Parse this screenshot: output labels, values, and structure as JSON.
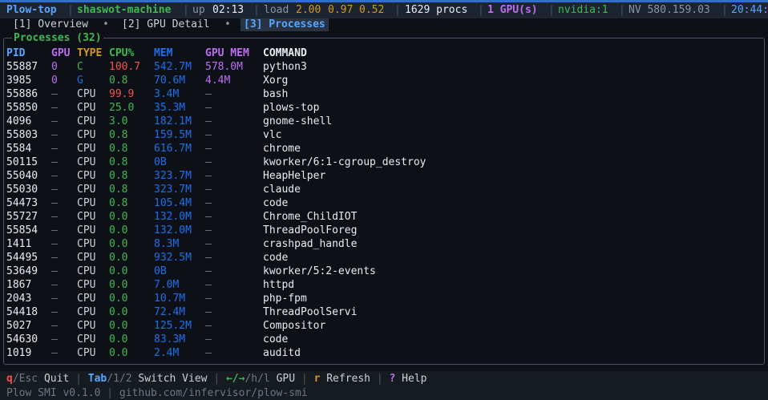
{
  "colors": {
    "header_pid": "#58a6ff",
    "header_gpu": "#bc6ff1",
    "header_type": "#d29922",
    "header_cpu": "#3fb950",
    "header_mem": "#1f6feb",
    "header_gmem": "#bc6ff1",
    "header_cmd": "#e6edf3",
    "cpu_high": "#f85149",
    "cpu_normal": "#3fb950",
    "mem": "#1f6feb",
    "gpu_index": "#bc6ff1",
    "type_compute": "#3fb950",
    "type_graphics": "#1f6feb",
    "type_cpu": "#c9d1d9",
    "dash": "#6e7681"
  },
  "topbar": {
    "app": "Plow-top",
    "host": "shaswot-machine",
    "uptime_label": "up",
    "uptime": "02:13",
    "load_label": "load",
    "load1": "2.00",
    "load5": "0.97",
    "load15": "0.52",
    "procs": "1629 procs",
    "gpus": "1 GPU(s)",
    "vendor": "nvidia:1",
    "driver": "NV 580.159.03",
    "clock": "20:44:"
  },
  "tabs": [
    {
      "label": "[1] Overview"
    },
    {
      "label": "[2] GPU Detail"
    },
    {
      "label": "[3] Processes"
    }
  ],
  "tab_separator": "•",
  "panel": {
    "title": "Processes (32)"
  },
  "table": {
    "headers": {
      "pid": "PID",
      "gpu": "GPU",
      "type": "TYPE",
      "cpu": "CPU%",
      "mem": "MEM",
      "gmem": "GPU MEM",
      "cmd": "COMMAND"
    },
    "rows": [
      {
        "pid": "55887",
        "gpu": "0",
        "type": "C",
        "cpu": "100.7",
        "mem": "542.7M",
        "gmem": "578.0M",
        "cmd": "python3"
      },
      {
        "pid": "3985",
        "gpu": "0",
        "type": "G",
        "cpu": "0.8",
        "mem": "70.6M",
        "gmem": "4.4M",
        "cmd": "Xorg"
      },
      {
        "pid": "55886",
        "gpu": "—",
        "type": "CPU",
        "cpu": "99.9",
        "mem": "3.4M",
        "gmem": "—",
        "cmd": "bash"
      },
      {
        "pid": "55850",
        "gpu": "—",
        "type": "CPU",
        "cpu": "25.0",
        "mem": "35.3M",
        "gmem": "—",
        "cmd": "plows-top"
      },
      {
        "pid": "4096",
        "gpu": "—",
        "type": "CPU",
        "cpu": "3.0",
        "mem": "182.1M",
        "gmem": "—",
        "cmd": "gnome-shell"
      },
      {
        "pid": "55803",
        "gpu": "—",
        "type": "CPU",
        "cpu": "0.8",
        "mem": "159.5M",
        "gmem": "—",
        "cmd": "vlc"
      },
      {
        "pid": "5584",
        "gpu": "—",
        "type": "CPU",
        "cpu": "0.8",
        "mem": "616.7M",
        "gmem": "—",
        "cmd": "chrome"
      },
      {
        "pid": "50115",
        "gpu": "—",
        "type": "CPU",
        "cpu": "0.8",
        "mem": "0B",
        "gmem": "—",
        "cmd": "kworker/6:1-cgroup_destroy"
      },
      {
        "pid": "55040",
        "gpu": "—",
        "type": "CPU",
        "cpu": "0.8",
        "mem": "323.7M",
        "gmem": "—",
        "cmd": "HeapHelper"
      },
      {
        "pid": "55030",
        "gpu": "—",
        "type": "CPU",
        "cpu": "0.8",
        "mem": "323.7M",
        "gmem": "—",
        "cmd": "claude"
      },
      {
        "pid": "54473",
        "gpu": "—",
        "type": "CPU",
        "cpu": "0.8",
        "mem": "105.4M",
        "gmem": "—",
        "cmd": "code"
      },
      {
        "pid": "55727",
        "gpu": "—",
        "type": "CPU",
        "cpu": "0.0",
        "mem": "132.0M",
        "gmem": "—",
        "cmd": "Chrome_ChildIOT"
      },
      {
        "pid": "55854",
        "gpu": "—",
        "type": "CPU",
        "cpu": "0.0",
        "mem": "132.0M",
        "gmem": "—",
        "cmd": "ThreadPoolForeg"
      },
      {
        "pid": "1411",
        "gpu": "—",
        "type": "CPU",
        "cpu": "0.0",
        "mem": "8.3M",
        "gmem": "—",
        "cmd": "crashpad_handle"
      },
      {
        "pid": "54495",
        "gpu": "—",
        "type": "CPU",
        "cpu": "0.0",
        "mem": "932.5M",
        "gmem": "—",
        "cmd": "code"
      },
      {
        "pid": "53649",
        "gpu": "—",
        "type": "CPU",
        "cpu": "0.0",
        "mem": "0B",
        "gmem": "—",
        "cmd": "kworker/5:2-events"
      },
      {
        "pid": "1867",
        "gpu": "—",
        "type": "CPU",
        "cpu": "0.0",
        "mem": "7.0M",
        "gmem": "—",
        "cmd": "httpd"
      },
      {
        "pid": "2043",
        "gpu": "—",
        "type": "CPU",
        "cpu": "0.0",
        "mem": "10.7M",
        "gmem": "—",
        "cmd": "php-fpm"
      },
      {
        "pid": "54418",
        "gpu": "—",
        "type": "CPU",
        "cpu": "0.0",
        "mem": "72.4M",
        "gmem": "—",
        "cmd": "ThreadPoolServi"
      },
      {
        "pid": "5027",
        "gpu": "—",
        "type": "CPU",
        "cpu": "0.0",
        "mem": "125.2M",
        "gmem": "—",
        "cmd": "Compositor"
      },
      {
        "pid": "54630",
        "gpu": "—",
        "type": "CPU",
        "cpu": "0.0",
        "mem": "83.3M",
        "gmem": "—",
        "cmd": "code"
      },
      {
        "pid": "1019",
        "gpu": "—",
        "type": "CPU",
        "cpu": "0.0",
        "mem": "2.4M",
        "gmem": "—",
        "cmd": "auditd"
      }
    ]
  },
  "footer": {
    "quit_key": "q",
    "quit_alt": "/Esc",
    "quit_label": "Quit",
    "tab_key": "Tab",
    "tab_alt": "/1/2",
    "tab_label": "Switch View",
    "gpu_key": "←/→",
    "gpu_alt": "/h/l",
    "gpu_label": "GPU",
    "refresh_key": "r",
    "refresh_label": "Refresh",
    "help_key": "?",
    "help_label": "Help",
    "version": "Plow SMI v0.1.0",
    "repo": "github.com/infervisor/plow-smi"
  },
  "separator": "|"
}
